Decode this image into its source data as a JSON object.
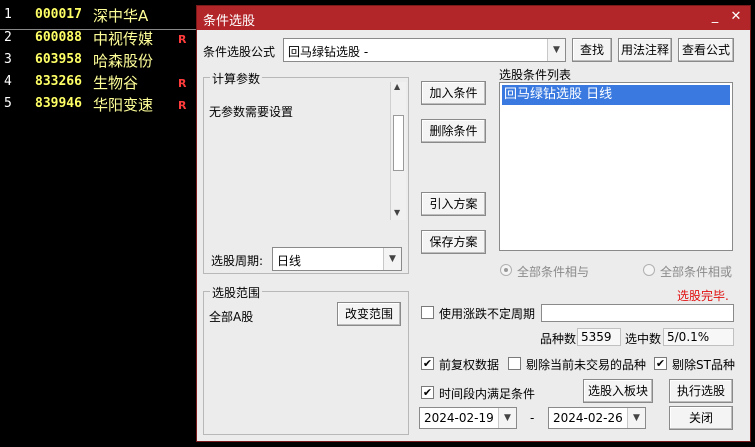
{
  "stocks": [
    {
      "idx": "1",
      "code": "000017",
      "name": "深中华A",
      "flag": ""
    },
    {
      "idx": "2",
      "code": "600088",
      "name": "中视传媒",
      "flag": "R"
    },
    {
      "idx": "3",
      "code": "603958",
      "name": "哈森股份",
      "flag": ""
    },
    {
      "idx": "4",
      "code": "833266",
      "name": "生物谷",
      "flag": "R"
    },
    {
      "idx": "5",
      "code": "839946",
      "name": "华阳变速",
      "flag": "R"
    }
  ],
  "dialog": {
    "title": "条件选股",
    "min_glyph": "_",
    "close_glyph": "✕",
    "formula_label": "条件选股公式",
    "formula_value": "回马绿钻选股 -",
    "find_btn": "查找",
    "usage_btn": "用法注释",
    "view_btn": "查看公式",
    "calc_group": "计算参数",
    "no_params": "无参数需要设置",
    "period_label": "选股周期:",
    "period_value": "日线",
    "add_cond_btn": "加入条件",
    "del_cond_btn": "删除条件",
    "import_plan_btn": "引入方案",
    "save_plan_btn": "保存方案",
    "cond_list_label": "选股条件列表",
    "cond_items": [
      "回马绿钻选股  日线"
    ],
    "radio_and": "全部条件相与",
    "radio_or": "全部条件相或",
    "status": "选股完毕.",
    "range_group": "选股范围",
    "range_value": "全部A股",
    "change_range_btn": "改变范围",
    "use_period_label": "使用涨跌不定周期",
    "count_label": "品种数",
    "count_value": "5359",
    "selected_label": "选中数",
    "selected_value": "5/0.1%",
    "fq_label": "前复权数据",
    "excl_suspended_label": "剔除当前未交易的品种",
    "excl_st_label": "剔除ST品种",
    "period_satisfy_label": "时间段内满足条件",
    "to_block_btn": "选股入板块",
    "run_btn": "执行选股",
    "date_from": "2024-02-19",
    "date_sep": "-",
    "date_to": "2024-02-26",
    "close_btn": "关闭",
    "check_glyph": "✔",
    "colors": {
      "title_bar": "#b2262a",
      "status": "#e01010",
      "selection": "#3a7ae0"
    }
  }
}
